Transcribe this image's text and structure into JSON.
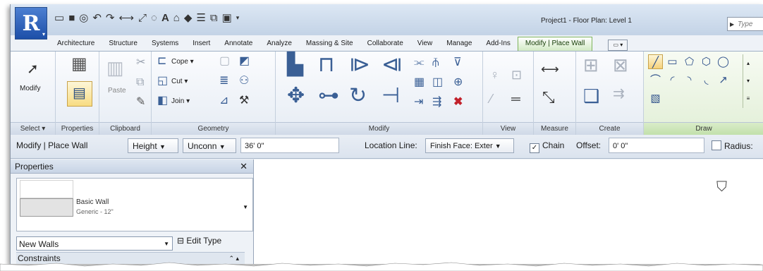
{
  "app": {
    "logo_letter": "R",
    "project_title": "Project1 - Floor Plan: Level 1",
    "search_placeholder": "Type"
  },
  "tabs": [
    "Architecture",
    "Structure",
    "Systems",
    "Insert",
    "Annotate",
    "Analyze",
    "Massing & Site",
    "Collaborate",
    "View",
    "Manage",
    "Add-Ins",
    "Modify | Place Wall"
  ],
  "active_tab": "Modify | Place Wall",
  "ribbon": {
    "select": {
      "title": "Select",
      "modify_label": "Modify"
    },
    "properties": {
      "title": "Properties"
    },
    "clipboard": {
      "title": "Clipboard",
      "paste_label": "Paste"
    },
    "geometry": {
      "title": "Geometry",
      "cope": "Cope",
      "cut": "Cut",
      "join": "Join"
    },
    "modify": {
      "title": "Modify"
    },
    "view": {
      "title": "View"
    },
    "measure": {
      "title": "Measure"
    },
    "create": {
      "title": "Create"
    },
    "draw": {
      "title": "Draw"
    }
  },
  "options": {
    "context": "Modify | Place Wall",
    "height": "Height",
    "unconn": "Unconn",
    "height_value": "36'  0\"",
    "location_label": "Location Line:",
    "location_value": "Finish Face: Exter",
    "chain_label": "Chain",
    "chain_checked": true,
    "offset_label": "Offset:",
    "offset_value": "0'  0\"",
    "radius_label": "Radius:",
    "radius_checked": false
  },
  "properties_palette": {
    "title": "Properties",
    "type_family": "Basic Wall",
    "type_name": "Generic - 12\"",
    "instance_filter": "New Walls",
    "edit_type": "Edit Type",
    "section": "Constraints"
  },
  "icons": [
    "revit-logo-icon",
    "open-icon",
    "save-icon",
    "undo-icon",
    "redo-icon",
    "measure-icon",
    "text-icon",
    "3d-view-icon",
    "modify-arrow-icon",
    "paste-icon",
    "cope-icon",
    "cut-icon",
    "join-icon",
    "align-icon",
    "move-icon",
    "rotate-icon",
    "delete-icon",
    "line-icon",
    "rectangle-icon",
    "polygon-icon",
    "circle-icon",
    "arc-icon",
    "pick-lines-icon"
  ]
}
